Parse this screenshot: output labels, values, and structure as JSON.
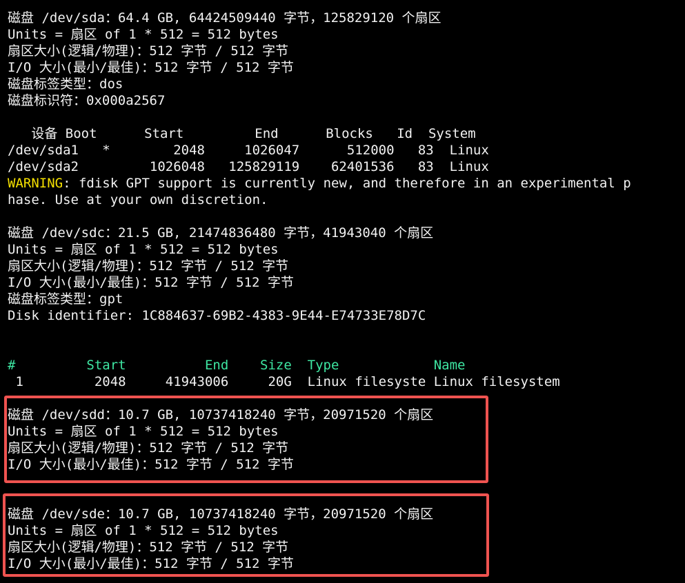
{
  "colors": {
    "background": "#000000",
    "text": "#f2f2f2",
    "warning": "#f5e000",
    "gpt_header": "#3ee6a2",
    "highlight_border": "#ef5350"
  },
  "lines": [
    "磁盘 /dev/sda：64.4 GB, 64424509440 字节，125829120 个扇区",
    "Units = 扇区 of 1 * 512 = 512 bytes",
    "扇区大小(逻辑/物理)：512 字节 / 512 字节",
    "I/O 大小(最小/最佳)：512 字节 / 512 字节",
    "磁盘标签类型：dos",
    "磁盘标识符：0x000a2567",
    "",
    "   设备 Boot      Start         End      Blocks   Id  System",
    "/dev/sda1   *        2048     1026047      512000   83  Linux",
    "/dev/sda2         1026048   125829119    62401536   83  Linux",
    "WARNING: fdisk GPT support is currently new, and therefore in an experimental p",
    "hase. Use at your own discretion.",
    "",
    "磁盘 /dev/sdc：21.5 GB, 21474836480 字节，41943040 个扇区",
    "Units = 扇区 of 1 * 512 = 512 bytes",
    "扇区大小(逻辑/物理)：512 字节 / 512 字节",
    "I/O 大小(最小/最佳)：512 字节 / 512 字节",
    "磁盘标签类型：gpt",
    "Disk identifier: 1C884637-69B2-4383-9E44-E74733E78D7C",
    "",
    "",
    "#         Start          End    Size  Type            Name",
    " 1         2048     41943006     20G  Linux filesyste Linux filesystem",
    "磁盘 /dev/sdd：10.7 GB, 10737418240 字节，20971520 个扇区",
    "Units = 扇区 of 1 * 512 = 512 bytes",
    "扇区大小(逻辑/物理)：512 字节 / 512 字节",
    "I/O 大小(最小/最佳)：512 字节 / 512 字节",
    "",
    "",
    "磁盘 /dev/sde：10.7 GB, 10737418240 字节，20971520 个扇区",
    "Units = 扇区 of 1 * 512 = 512 bytes",
    "扇区大小(逻辑/物理)：512 字节 / 512 字节",
    "I/O 大小(最小/最佳)：512 字节 / 512 字节"
  ],
  "warning_label": "WARNING",
  "warning_rest": ": fdisk GPT support is currently new, and therefore in an experimental p"
}
